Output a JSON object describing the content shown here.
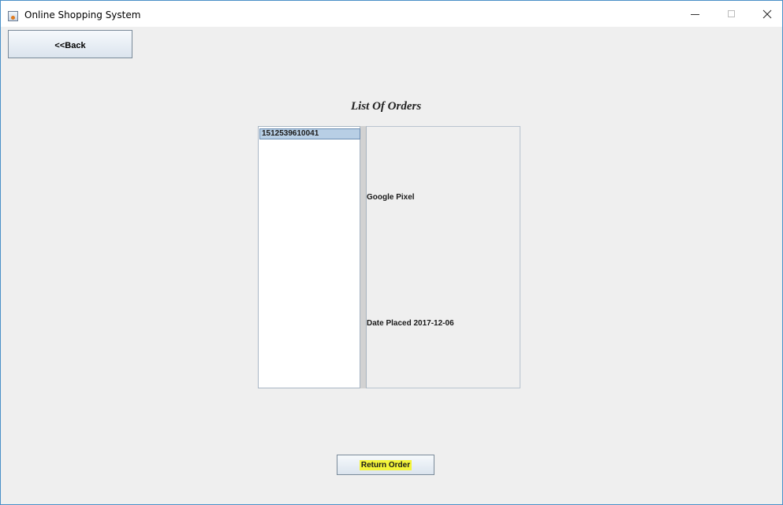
{
  "window": {
    "title": "Online Shopping System",
    "controls": {
      "minimize_icon": "minimize-icon",
      "maximize_icon": "maximize-icon",
      "close_icon": "close-icon"
    }
  },
  "toolbar": {
    "back_label": "<<Back"
  },
  "orders": {
    "heading": "List Of Orders",
    "items": [
      {
        "id": "1512539610041",
        "selected": true
      }
    ]
  },
  "detail": {
    "product": "Google Pixel",
    "date_placed": "Date Placed 2017-12-06"
  },
  "actions": {
    "return_label": "Return Order"
  },
  "colors": {
    "window_border": "#4a90c8",
    "background": "#efefef",
    "selection": "#b8cfe5",
    "highlight": "#f4f43a"
  }
}
